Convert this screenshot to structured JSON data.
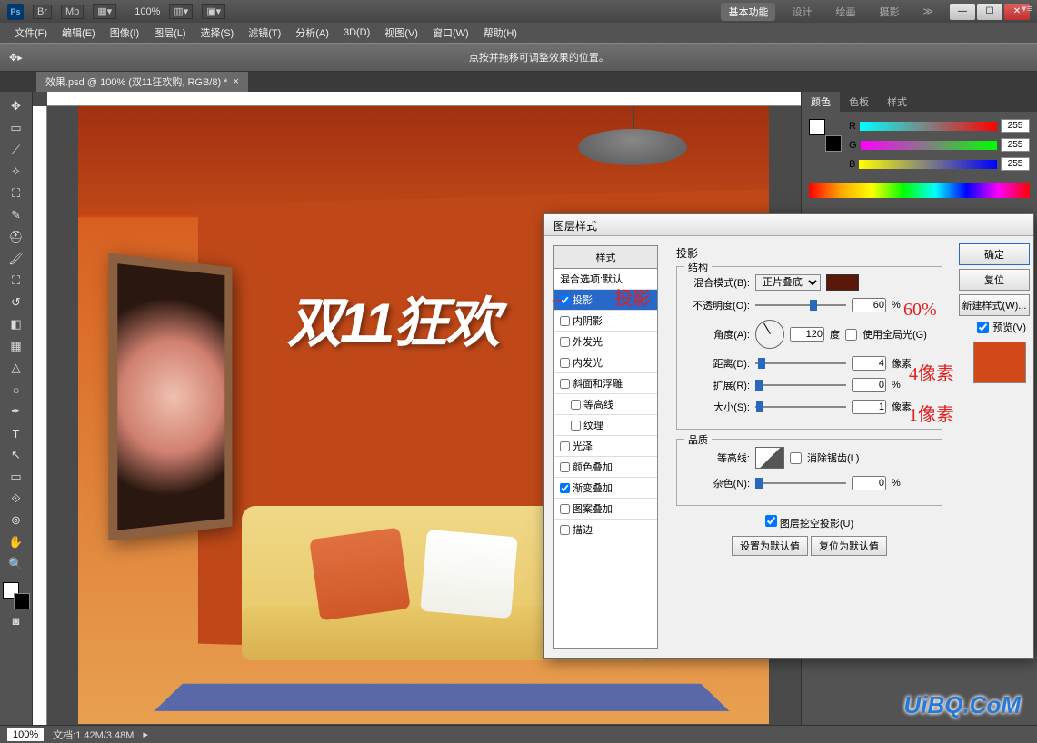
{
  "titlebar": {
    "ps_label": "Ps",
    "br_label": "Br",
    "mb_label": "Mb",
    "zoom": "100%",
    "tabs": {
      "basic": "基本功能",
      "design": "设计",
      "painting": "绘画",
      "photography": "摄影"
    }
  },
  "menu": {
    "file": "文件(F)",
    "edit": "编辑(E)",
    "image": "图像(I)",
    "layer": "图层(L)",
    "select": "选择(S)",
    "filter": "滤镜(T)",
    "analysis": "分析(A)",
    "threed": "3D(D)",
    "view": "视图(V)",
    "window": "窗口(W)",
    "help": "帮助(H)"
  },
  "options": {
    "hint": "点按并拖移可调整效果的位置。"
  },
  "doctab": {
    "title": "效果.psd @ 100% (双11狂欢购, RGB/8) *",
    "close": "×"
  },
  "canvas": {
    "text_3d": "双11狂欢"
  },
  "color_panel": {
    "tabs": {
      "color": "颜色",
      "swatches": "色板",
      "styles": "样式"
    },
    "r_label": "R",
    "g_label": "G",
    "b_label": "B",
    "r_val": "255",
    "g_val": "255",
    "b_val": "255"
  },
  "dialog": {
    "title": "图层样式",
    "list_head": "样式",
    "items": {
      "blend_default": "混合选项:默认",
      "drop_shadow": "投影",
      "inner_shadow": "内阴影",
      "outer_glow": "外发光",
      "inner_glow": "内发光",
      "bevel": "斜面和浮雕",
      "contour_item": "等高线",
      "texture": "纹理",
      "satin": "光泽",
      "color_overlay": "颜色叠加",
      "gradient_overlay": "渐变叠加",
      "pattern_overlay": "图案叠加",
      "stroke": "描边"
    },
    "section_shadow": "投影",
    "group_structure": "结构",
    "blend_mode_label": "混合模式(B):",
    "blend_mode_value": "正片叠底",
    "opacity_label": "不透明度(O):",
    "opacity_value": "60",
    "opacity_unit": "%",
    "angle_label": "角度(A):",
    "angle_value": "120",
    "angle_unit": "度",
    "global_light": "使用全局光(G)",
    "distance_label": "距离(D):",
    "distance_value": "4",
    "distance_unit": "像素",
    "spread_label": "扩展(R):",
    "spread_value": "0",
    "spread_unit": "%",
    "size_label": "大小(S):",
    "size_value": "1",
    "size_unit": "像素",
    "group_quality": "品质",
    "contour_label": "等高线:",
    "antialias": "消除锯齿(L)",
    "noise_label": "杂色(N):",
    "noise_value": "0",
    "noise_unit": "%",
    "knockout": "图层挖空投影(U)",
    "reset_default": "设置为默认值",
    "restore_default": "复位为默认值",
    "btn_ok": "确定",
    "btn_cancel": "复位",
    "btn_new_style": "新建样式(W)...",
    "preview": "预览(V)"
  },
  "annotations": {
    "shadow": "投影",
    "pct60": "60%",
    "px4": "4像素",
    "px1": "1像素"
  },
  "status": {
    "zoom": "100%",
    "doc_info": "文档:1.42M/3.48M"
  },
  "watermark": "UiBQ.CoM"
}
